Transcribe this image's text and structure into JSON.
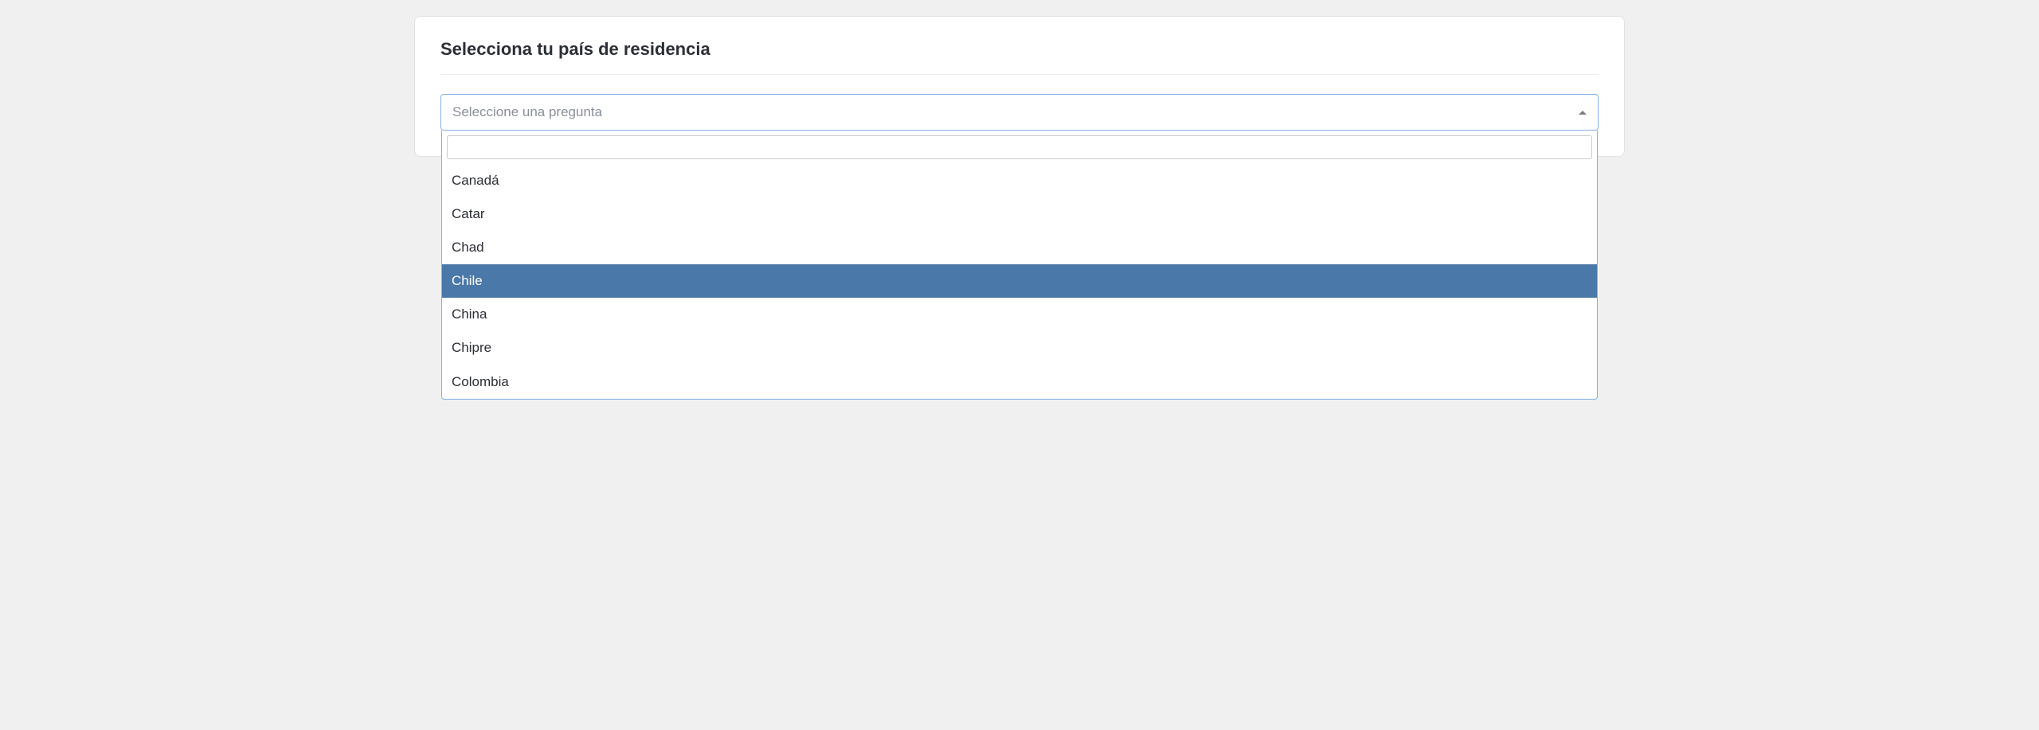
{
  "title": "Selecciona tu país de residencia",
  "select": {
    "placeholder": "Seleccione una pregunta"
  },
  "options": {
    "item0": "Canadá",
    "item1": "Catar",
    "item2": "Chad",
    "item3": "Chile",
    "item4": "China",
    "item5": "Chipre",
    "item6": "Colombia"
  },
  "highlightedIndex": 3
}
